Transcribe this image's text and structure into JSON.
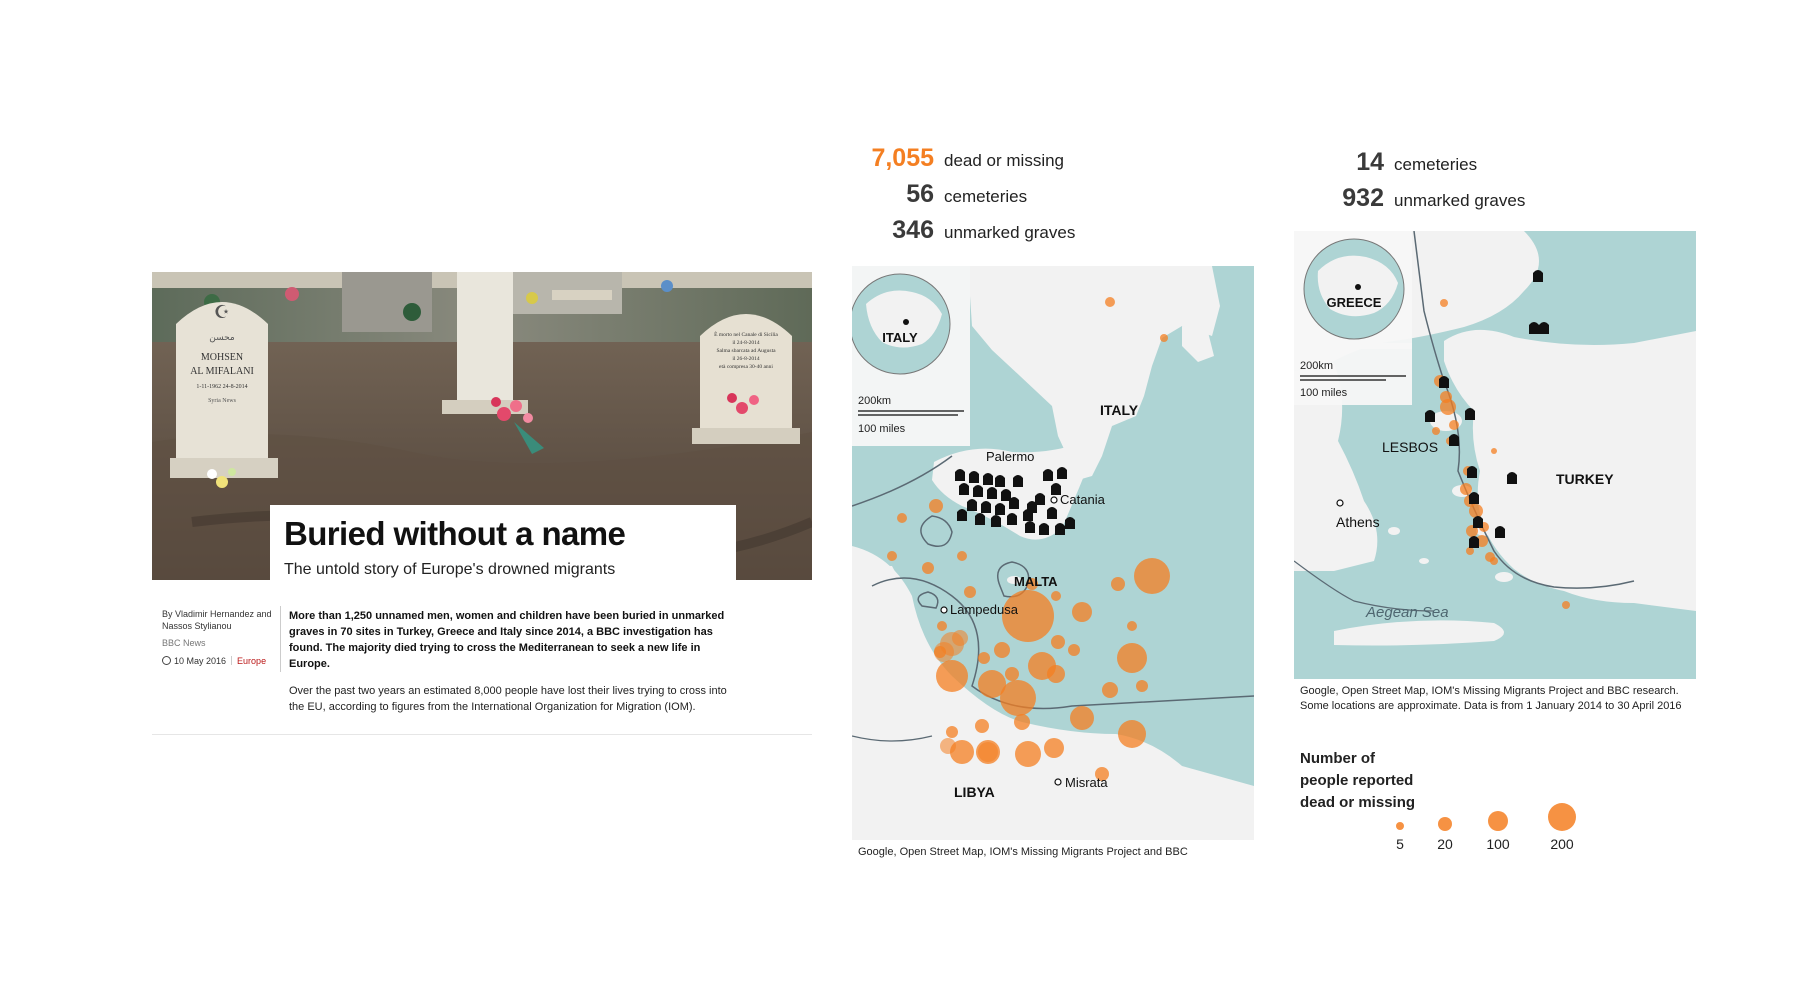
{
  "article": {
    "headline": "Buried without a name",
    "subheadline": "The untold story of Europe's drowned migrants",
    "byline": "By Vladimir Hernandez and Nassos Stylianou",
    "source": "BBC News",
    "date": "10 May 2016",
    "tag": "Europe",
    "intro": "More than 1,250 unnamed men, women and children have been buried in unmarked graves in 70 sites in Turkey, Greece and Italy since 2014, a BBC investigation has found. The majority died trying to cross the Mediterranean to seek a new life in Europe.",
    "paragraph": "Over the past two years an estimated 8,000 people have lost their lives trying to cross into the EU, according to figures from the International Organization for Migration (IOM).",
    "photo": {
      "grave_left_text": [
        "محسن",
        "MOHSEN",
        "AL MIFALANI",
        "1-11-1962   24-8-2014",
        "Syria News"
      ],
      "grave_right_text": [
        "È morto nel Canale di Sicilia",
        "il 24-8-2014",
        "Salma sbarcata ad Augusta",
        "il 26-8-2014",
        "età compresa 30-40 anni"
      ]
    }
  },
  "italy": {
    "stats": [
      {
        "value": "7,055",
        "label": "dead or missing",
        "highlight": true
      },
      {
        "value": "56",
        "label": "cemeteries",
        "highlight": false
      },
      {
        "value": "346",
        "label": "unmarked graves",
        "highlight": false
      }
    ],
    "inset_label": "ITALY",
    "scale_km": "200km",
    "scale_miles": "100 miles",
    "places": {
      "italy": "ITALY",
      "palermo": "Palermo",
      "catania": "Catania",
      "malta": "MALTA",
      "lampedusa": "Lampedusa",
      "libya": "LIBYA",
      "misrata": "Misrata"
    },
    "caption": "Google, Open Street Map, IOM's Missing Migrants Project and BBC"
  },
  "greece": {
    "stats": [
      {
        "value": "14",
        "label": "cemeteries"
      },
      {
        "value": "932",
        "label": "unmarked graves"
      }
    ],
    "inset_label": "GREECE",
    "scale_km": "200km",
    "scale_miles": "100 miles",
    "places": {
      "lesbos": "LESBOS",
      "athens": "Athens",
      "turkey": "TURKEY",
      "aegean": "Aegean Sea"
    },
    "caption": "Google, Open Street Map, IOM's Missing Migrants Project and BBC research. Some locations are approximate. Data is from 1 January 2014 to 30 April 2016"
  },
  "legend": {
    "title": "Number of\npeople reported\ndead or missing",
    "items": [
      {
        "label": "5"
      },
      {
        "label": "20"
      },
      {
        "label": "100"
      },
      {
        "label": "200"
      }
    ]
  },
  "colors": {
    "sea": "#aed4d4",
    "land": "#f2f2f2",
    "circle": "#f47f22",
    "highlight": "#f47f22",
    "text": "#222222"
  }
}
